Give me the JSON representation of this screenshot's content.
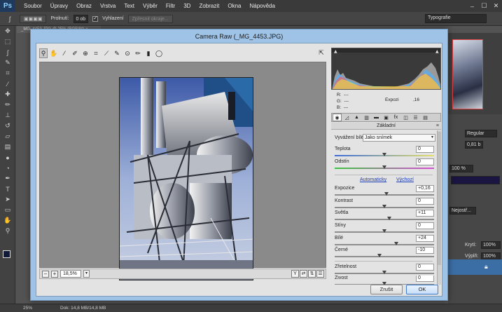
{
  "app": {
    "logo": "Ps",
    "menu": [
      "Soubor",
      "Úpravy",
      "Obraz",
      "Vrstva",
      "Text",
      "Výběr",
      "Filtr",
      "3D",
      "Zobrazit",
      "Okna",
      "Nápověda"
    ],
    "window_controls": [
      "–",
      "☐",
      "✕"
    ]
  },
  "options_bar": {
    "feather_label": "Prolnutí:",
    "feather_value": "0 ob",
    "antialias_label": "Vyhlazení",
    "antialias_checked": true,
    "refine_edge_label": "Zpřesnit okraje...",
    "workspace": "Typografie"
  },
  "document_tab": "_MG_4453.JPG @ 25% (RGB/8*) ×",
  "status_bar": {
    "zoom": "25%",
    "doc_size": "Dok: 14,8 MB/14,8 MB"
  },
  "right_panel": {
    "font_style": "Regular",
    "size_value": "0,81 b",
    "scale_value": "100 %",
    "tracking_label": "Nejostř...",
    "opacity_label": "Krytí:",
    "opacity_value": "100%",
    "fill_label": "Výplň:",
    "fill_value": "100%",
    "lock_icon": "lock-icon"
  },
  "dialog": {
    "title": "Camera Raw (_MG_4453.JPG)",
    "tools": [
      "zoom-icon",
      "hand-icon",
      "white-balance-icon",
      "color-sampler-icon",
      "target-adjust-icon",
      "crop-icon",
      "straighten-icon",
      "spot-removal-icon",
      "red-eye-icon",
      "adjustment-brush-icon",
      "graduated-filter-icon",
      "radial-filter-icon"
    ],
    "zoom_level": "18,5%",
    "readout": {
      "r_label": "R:",
      "r_value": "---",
      "g_label": "G:",
      "g_value": "---",
      "b_label": "B:",
      "b_value": "---",
      "exposure_label": "Expozi",
      "exposure_value": ",16"
    },
    "panel_title": "Základní",
    "white_balance": {
      "label": "Vyvážení bílé:",
      "value": "Jako snímek"
    },
    "sliders_top": [
      {
        "label": "Teplota",
        "value": "0",
        "level": 0.5
      },
      {
        "label": "Odstín",
        "value": "0",
        "level": 0.5
      }
    ],
    "auto_label": "Automaticky",
    "default_label": "Výchozí",
    "sliders_main": [
      {
        "label": "Expozice",
        "value": "+0,16",
        "level": 0.52
      },
      {
        "label": "Kontrast",
        "value": "0",
        "level": 0.5
      },
      {
        "label": "Světla",
        "value": "+11",
        "level": 0.55
      },
      {
        "label": "Stíny",
        "value": "0",
        "level": 0.5
      },
      {
        "label": "Bílé",
        "value": "+24",
        "level": 0.62
      },
      {
        "label": "Černé",
        "value": "-10",
        "level": 0.45
      }
    ],
    "sliders_bottom": [
      {
        "label": "Zřetelnost",
        "value": "0",
        "level": 0.5
      },
      {
        "label": "Živost",
        "value": "0",
        "level": 0.5
      }
    ],
    "cancel_label": "Zrušit",
    "ok_label": "OK"
  }
}
